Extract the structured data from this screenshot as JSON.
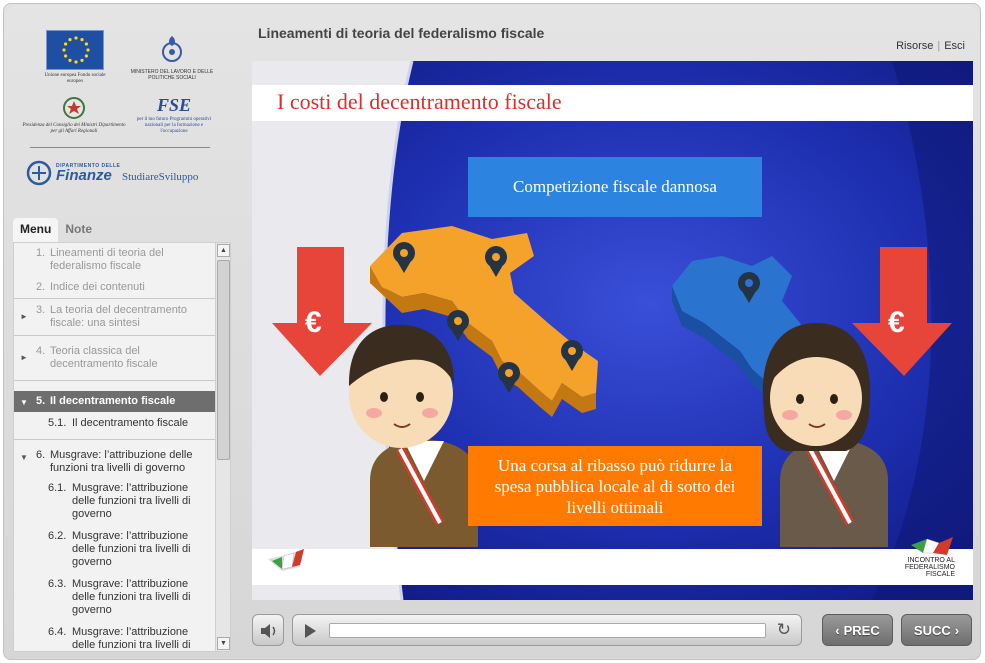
{
  "header": {
    "course_title": "Lineamenti di teoria del federalismo fiscale",
    "link_resources": "Risorse",
    "link_exit": "Esci"
  },
  "logos": {
    "eu_caption": "Unione europea Fondo sociale europeo",
    "ministry_caption": "MINISTERO DEL LAVORO E DELLE POLITICHE SOCIALI",
    "presidency_caption": "Presidenza del Consiglio dei Ministri Dipartimento per gli Affari Regionali",
    "fse_caption": "per il tuo futuro Programmi operativi nazionali per la formazione e l'occupazione",
    "fse_mark": "FSE",
    "finanze_top": "DIPARTIMENTO DELLE",
    "finanze_main": "Finanze",
    "studiare": "StudiareSviluppo"
  },
  "tabs": [
    "Menu",
    "Note"
  ],
  "menu": {
    "items": [
      {
        "num": "1.",
        "label": "Lineamenti di teoria del federalismo fiscale",
        "state": "visited",
        "arrow": ""
      },
      {
        "num": "2.",
        "label": "Indice dei contenuti",
        "state": "visited",
        "arrow": ""
      },
      {
        "num": "3.",
        "label": "La teoria del decentramento fiscale: una sintesi",
        "state": "visited",
        "arrow": "►"
      },
      {
        "num": "4.",
        "label": "Teoria classica del decentramento fiscale",
        "state": "visited",
        "arrow": "►"
      },
      {
        "num": "5.",
        "label": "Il decentramento fiscale",
        "state": "active",
        "arrow": "▼"
      },
      {
        "num": "6.",
        "label": "Musgrave: l’attribuzione delle funzioni tra livelli di governo",
        "state": "normal",
        "arrow": "▼"
      }
    ],
    "sub5": [
      {
        "num": "5.1.",
        "label": "Il decentramento fiscale"
      }
    ],
    "sub6": [
      {
        "num": "6.1.",
        "label": "Musgrave: l’attribuzione delle funzioni tra livelli di governo"
      },
      {
        "num": "6.2.",
        "label": "Musgrave: l’attribuzione delle funzioni tra livelli di governo"
      },
      {
        "num": "6.3.",
        "label": "Musgrave: l’attribuzione delle funzioni tra livelli di governo"
      },
      {
        "num": "6.4.",
        "label": "Musgrave: l’attribuzione delle funzioni tra livelli di governo"
      }
    ]
  },
  "slide": {
    "title": "I costi del decentramento fiscale",
    "box_top": "Competizione fiscale dannosa",
    "box_bottom": "Una corsa al ribasso può ridurre la spesa pubblica locale al di sotto dei livelli ottimali",
    "euro_symbol": "€",
    "footer_logo": "INCONTRO AL FEDERALISMO FISCALE"
  },
  "player": {
    "prev_label": "PREC",
    "next_label": "SUCC",
    "progress": 0.0
  },
  "colors": {
    "slide_bg": "#16249c",
    "title_red": "#d8312a",
    "box_blue": "#2d84e0",
    "box_orange": "#ff7a00",
    "arrow_red": "#e8453a",
    "map_orange": "#f4a22a",
    "map_blue": "#2a74d0"
  }
}
